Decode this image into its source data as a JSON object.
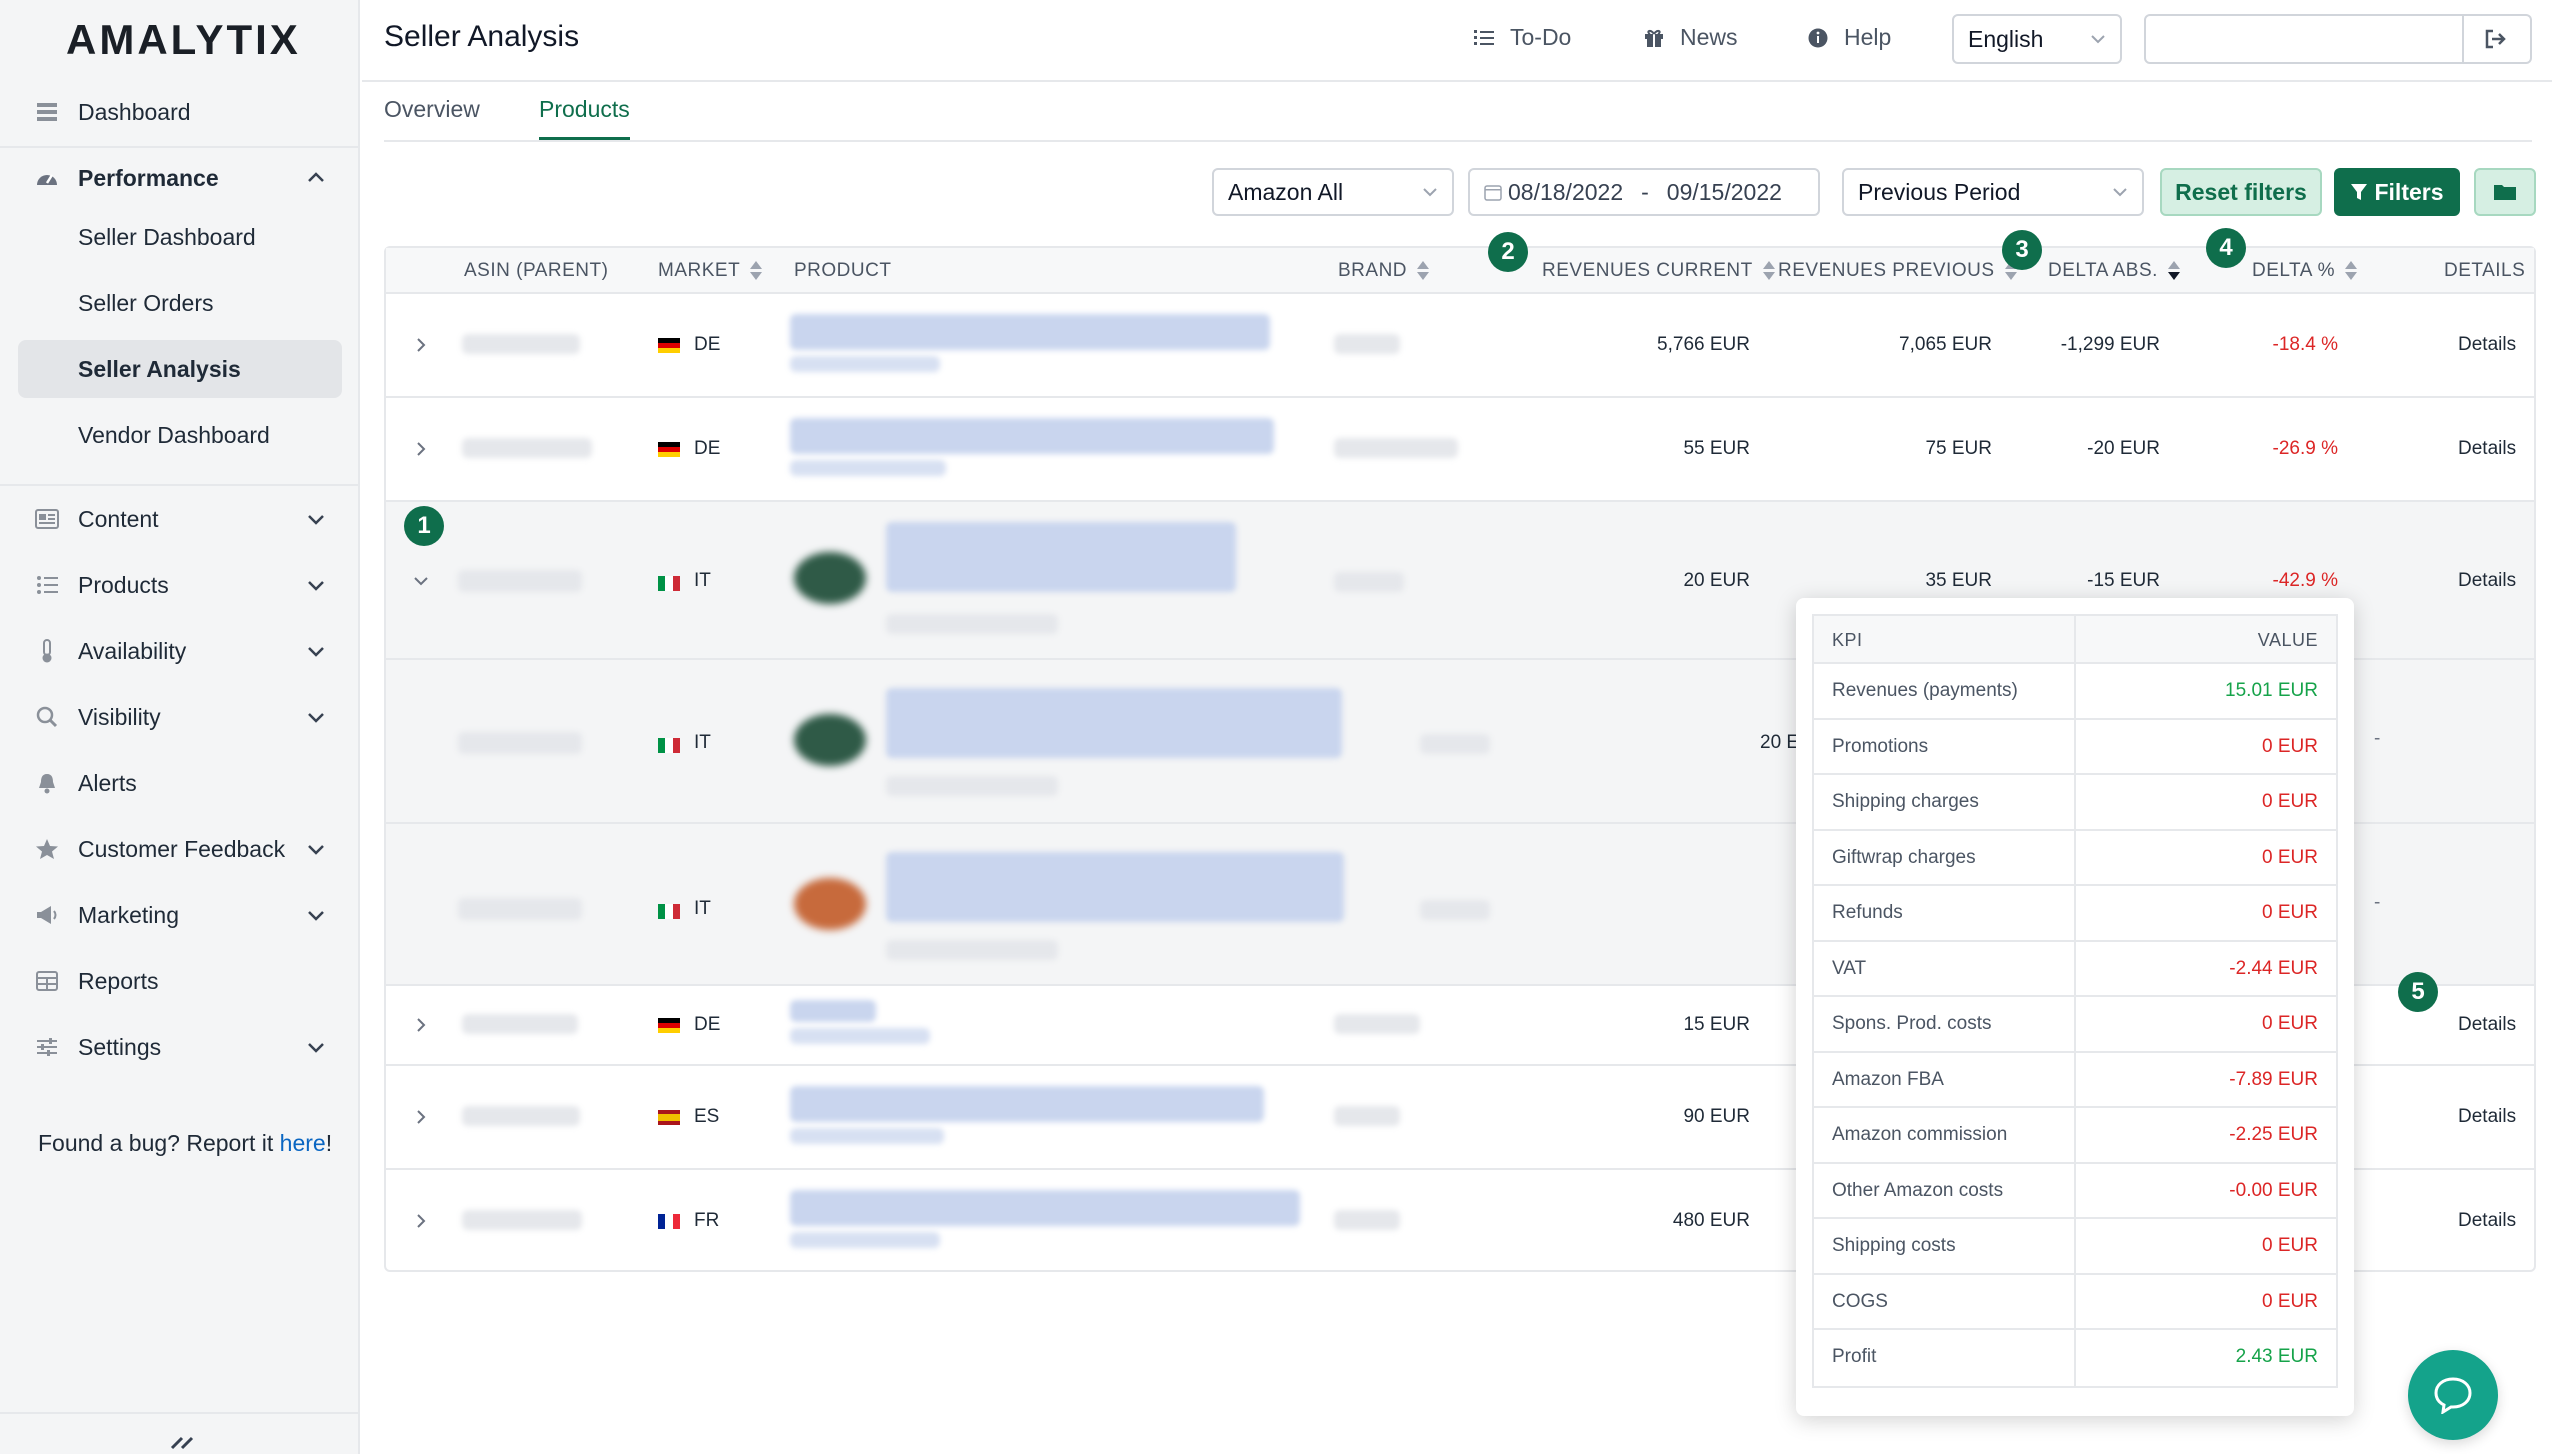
{
  "brand": {
    "logo": "AMALYTIX"
  },
  "sidebar": {
    "dashboard": "Dashboard",
    "performance": "Performance",
    "sub": [
      "Seller Dashboard",
      "Seller Orders",
      "Seller Analysis",
      "Vendor Dashboard"
    ],
    "content": "Content",
    "products": "Products",
    "availability": "Availability",
    "visibility": "Visibility",
    "alerts": "Alerts",
    "customer_feedback": "Customer Feedback",
    "marketing": "Marketing",
    "reports": "Reports",
    "settings": "Settings",
    "bug_prefix": "Found a bug? Report it ",
    "bug_link": "here",
    "bug_suffix": "!"
  },
  "header": {
    "title": "Seller Analysis",
    "todo": "To-Do",
    "news": "News",
    "help": "Help",
    "language": "English"
  },
  "tabs": {
    "overview": "Overview",
    "products": "Products"
  },
  "filters": {
    "marketplace": "Amazon All",
    "date_from": "08/18/2022",
    "date_sep": "-",
    "date_to": "09/15/2022",
    "comparison": "Previous Period",
    "reset": "Reset filters",
    "filters": "Filters"
  },
  "table": {
    "columns": {
      "asin": "ASIN (PARENT)",
      "market": "MARKET",
      "product": "PRODUCT",
      "brand": "BRAND",
      "rev_current": "REVENUES CURRENT",
      "rev_previous": "REVENUES PREVIOUS",
      "delta_abs": "DELTA ABS.",
      "delta_pct": "DELTA %",
      "details": "DETAILS"
    },
    "rows": [
      {
        "market": "DE",
        "rev_current": "5,766 EUR",
        "rev_previous": "7,065 EUR",
        "delta_abs": "-1,299 EUR",
        "delta_pct": "-18.4 %",
        "details": "Details"
      },
      {
        "market": "DE",
        "rev_current": "55 EUR",
        "rev_previous": "75 EUR",
        "delta_abs": "-20 EUR",
        "delta_pct": "-26.9 %",
        "details": "Details"
      },
      {
        "market": "IT",
        "rev_current": "20 EUR",
        "rev_previous": "35 EUR",
        "delta_abs": "-15 EUR",
        "delta_pct": "-42.9 %",
        "details": "Details"
      },
      {
        "market": "IT",
        "rev_current": "20 E",
        "details": "-"
      },
      {
        "market": "IT",
        "details": "-"
      },
      {
        "market": "DE",
        "rev_current": "15 EUR",
        "details": "Details"
      },
      {
        "market": "ES",
        "rev_current": "90 EUR",
        "details": "Details"
      },
      {
        "market": "FR",
        "rev_current": "480 EUR",
        "details": "Details"
      }
    ]
  },
  "badges": [
    "1",
    "2",
    "3",
    "4",
    "5"
  ],
  "kpi": {
    "head_kpi": "KPI",
    "head_value": "VALUE",
    "rows": [
      {
        "label": "Revenues (payments)",
        "value": "15.01 EUR"
      },
      {
        "label": "Promotions",
        "value": "0 EUR"
      },
      {
        "label": "Shipping charges",
        "value": "0 EUR"
      },
      {
        "label": "Giftwrap charges",
        "value": "0 EUR"
      },
      {
        "label": "Refunds",
        "value": "0 EUR"
      },
      {
        "label": "VAT",
        "value": "-2.44 EUR"
      },
      {
        "label": "Spons. Prod. costs",
        "value": "0 EUR"
      },
      {
        "label": "Amazon FBA",
        "value": "-7.89 EUR"
      },
      {
        "label": "Amazon commission",
        "value": "-2.25 EUR"
      },
      {
        "label": "Other Amazon costs",
        "value": "-0.00 EUR"
      },
      {
        "label": "Shipping costs",
        "value": "0 EUR"
      },
      {
        "label": "COGS",
        "value": "0 EUR"
      },
      {
        "label": "Profit",
        "value": "2.43 EUR"
      }
    ]
  },
  "colors": {
    "accent": "#0f6e4c",
    "negative": "#dc2626",
    "positive": "#16a34a",
    "chat": "#14a38b"
  }
}
